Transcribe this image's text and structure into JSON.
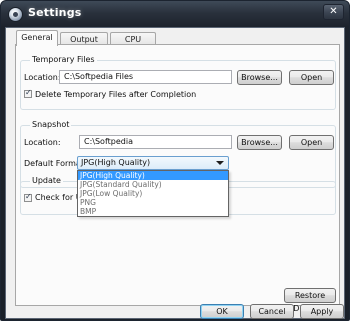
{
  "window": {
    "title": "Settings",
    "close_glyph": "✕"
  },
  "tabs": [
    {
      "label": "General",
      "active": true
    },
    {
      "label": "Output",
      "active": false
    },
    {
      "label": "CPU",
      "active": false
    }
  ],
  "temporary_files": {
    "legend": "Temporary Files",
    "location_label": "Location:",
    "location_value": "C:\\Softpedia Files",
    "browse_label": "Browse...",
    "open_label": "Open",
    "delete_checkbox_label": "Delete Temporary Files after Completion",
    "delete_checked": true
  },
  "snapshot": {
    "legend": "Snapshot",
    "location_label": "Location:",
    "location_value": "C:\\Softpedia",
    "browse_label": "Browse...",
    "open_label": "Open",
    "format_label": "Default Format:",
    "format_value": "JPG(High Quality)",
    "format_options": [
      "JPG(High Quality)",
      "JPG(Standard Quality)",
      "JPG(Low Quality)",
      "PNG",
      "BMP"
    ],
    "selected_option": "JPG(High Quality)"
  },
  "update": {
    "legend": "Update",
    "check_label": "Check for Upd",
    "checked": true
  },
  "footer": {
    "restore_defaults_label": "Restore Defaults",
    "ok_label": "OK",
    "cancel_label": "Cancel",
    "apply_label": "Apply"
  },
  "colors": {
    "titlebar": "#1d232c",
    "dialog_background": "#f0f0f0",
    "selection": "#3399ff",
    "default_button_border": "#3c7fb1"
  }
}
